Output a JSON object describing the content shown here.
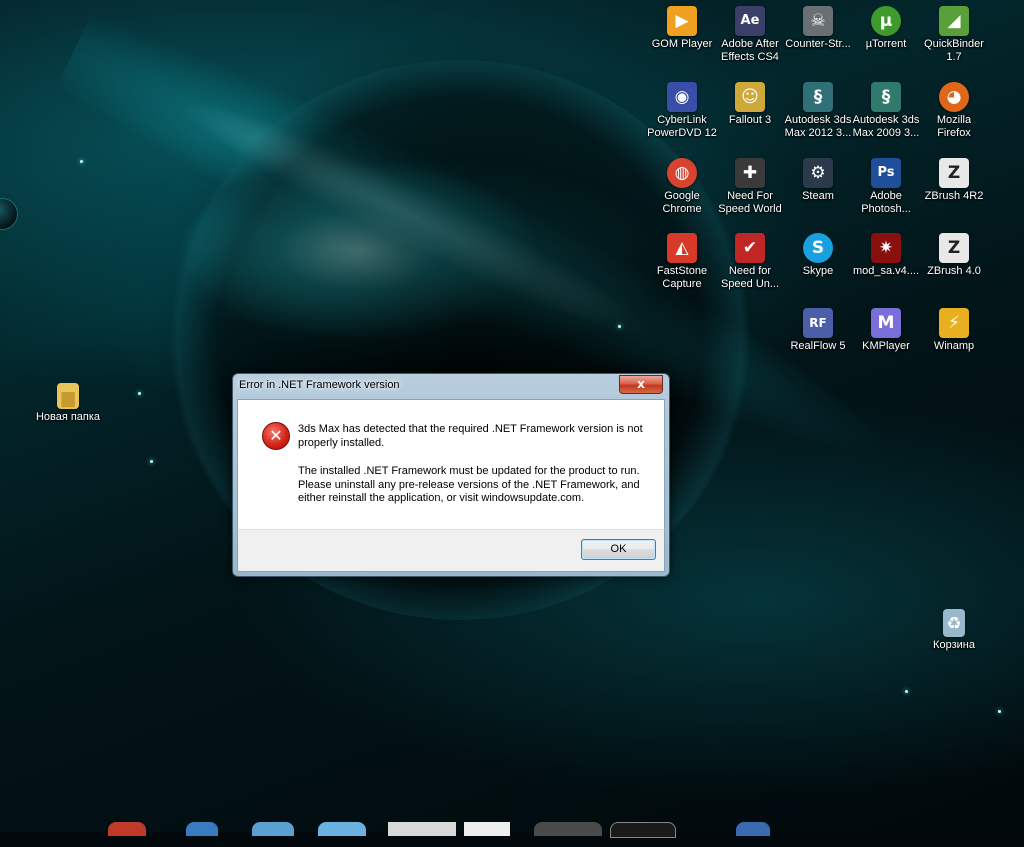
{
  "desktop": {
    "icons": [
      {
        "label": "GOM Player",
        "icon": "gom-player-icon",
        "glyph": "▶",
        "color": "#f0a020"
      },
      {
        "label": "Adobe After\nEffects CS4",
        "icon": "after-effects-icon",
        "glyph": "Ae",
        "color": "#3a3f6a"
      },
      {
        "label": "Counter-Str...",
        "icon": "counter-strike-icon",
        "glyph": "☠",
        "color": "#6a6f74"
      },
      {
        "label": "µTorrent",
        "icon": "utorrent-icon",
        "glyph": "µ",
        "color": "#3f9a2c"
      },
      {
        "label": "QuickBinder\n1.7",
        "icon": "quickbinder-icon",
        "glyph": "◢",
        "color": "#5aa03a"
      },
      {
        "label": "CyberLink\nPowerDVD 12",
        "icon": "powerdvd-icon",
        "glyph": "◉",
        "color": "#3a4ea8"
      },
      {
        "label": "Fallout 3",
        "icon": "fallout-icon",
        "glyph": "☺",
        "color": "#cfa83a"
      },
      {
        "label": "Autodesk 3ds\nMax 2012 3...",
        "icon": "3ds-max-2012-icon",
        "glyph": "§",
        "color": "#2f6f77"
      },
      {
        "label": "Autodesk 3ds\nMax 2009 3...",
        "icon": "3ds-max-2009-icon",
        "glyph": "§",
        "color": "#2f7a6c"
      },
      {
        "label": "Mozilla\nFirefox",
        "icon": "firefox-icon",
        "glyph": "◕",
        "color": "#e0661a"
      },
      {
        "label": "Google\nChrome",
        "icon": "chrome-icon",
        "glyph": "◍",
        "color": "#d9422f"
      },
      {
        "label": "Need For\nSpeed World",
        "icon": "nfs-world-icon",
        "glyph": "✚",
        "color": "#3a3a3a"
      },
      {
        "label": "Steam",
        "icon": "steam-icon",
        "glyph": "⚙",
        "color": "#2a3a4a"
      },
      {
        "label": "Adobe\nPhotosh...",
        "icon": "photoshop-icon",
        "glyph": "Ps",
        "color": "#1f4f9a"
      },
      {
        "label": "ZBrush 4R2",
        "icon": "zbrush-4r2-icon",
        "glyph": "Z",
        "color": "#e8e8e8"
      },
      {
        "label": "FastStone\nCapture",
        "icon": "faststone-icon",
        "glyph": "◭",
        "color": "#d83a2a"
      },
      {
        "label": "Need for\nSpeed Un...",
        "icon": "nfs-undercover-icon",
        "glyph": "✔",
        "color": "#c02626"
      },
      {
        "label": "Skype",
        "icon": "skype-icon",
        "glyph": "S",
        "color": "#18a0e0"
      },
      {
        "label": "mod_sa.v4....",
        "icon": "mod-sa-icon",
        "glyph": "✷",
        "color": "#8a1010"
      },
      {
        "label": "ZBrush 4.0",
        "icon": "zbrush-40-icon",
        "glyph": "Z",
        "color": "#e8e8e8"
      },
      {
        "label": "RealFlow 5",
        "icon": "realflow-icon",
        "glyph": "RF",
        "color": "#4a5fa8"
      },
      {
        "label": "KMPlayer",
        "icon": "kmplayer-icon",
        "glyph": "M",
        "color": "#7a6fd8"
      },
      {
        "label": "Winamp",
        "icon": "winamp-icon",
        "glyph": "⚡",
        "color": "#e8b020"
      },
      {
        "label": "Новая папка",
        "icon": "folder-icon",
        "glyph": "▆",
        "color": "#e8c45a"
      },
      {
        "label": "Корзина",
        "icon": "recycle-bin-icon",
        "glyph": "♻",
        "color": "#9ab8cc"
      }
    ]
  },
  "dialog": {
    "title": "Error in .NET Framework version",
    "close_glyph": "x",
    "icon": "error-icon",
    "icon_glyph": "✕",
    "message_line1": "3ds Max has detected that the required .NET Framework version is not properly installed.",
    "message_line2": "The installed .NET Framework must be updated for the product to run. Please uninstall any pre-release versions of the .NET Framework, and either reinstall the application, or visit windowsupdate.com.",
    "ok_label": "OK"
  }
}
